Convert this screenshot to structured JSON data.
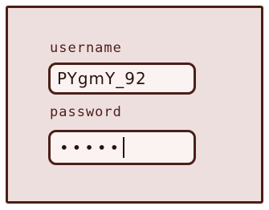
{
  "form": {
    "username_label": "username",
    "username_value": "PYgmY_92",
    "password_label": "password",
    "password_mask": "•••••"
  },
  "colors": {
    "background": "#eedfdf",
    "ink": "#4a1f18",
    "field_fill": "#fbf3f2"
  }
}
